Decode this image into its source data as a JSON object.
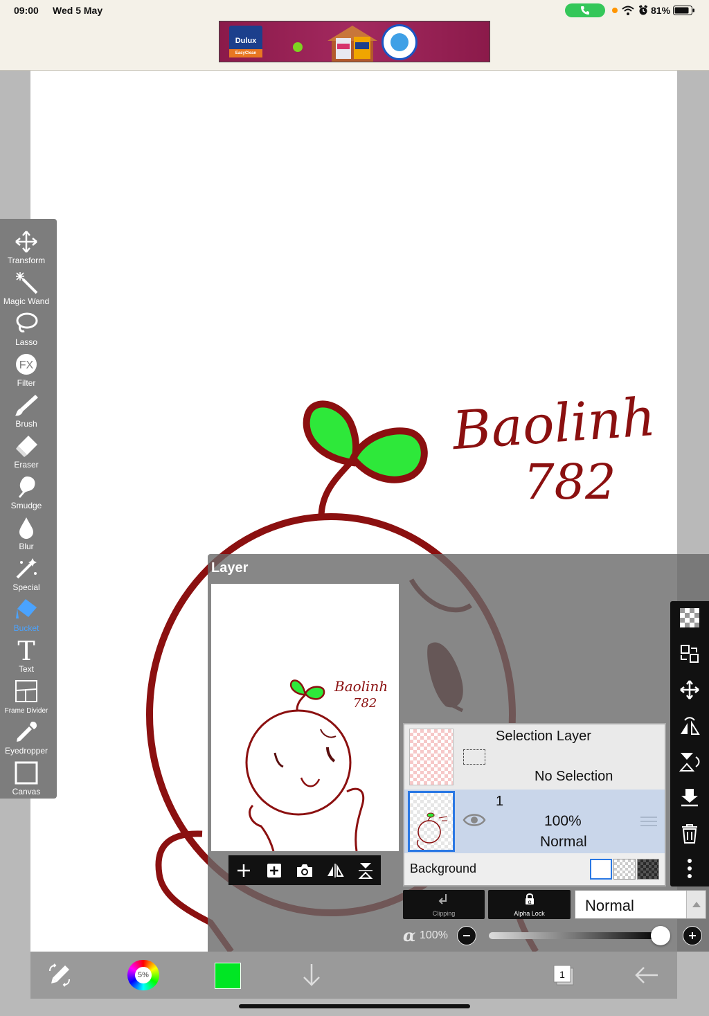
{
  "status_bar": {
    "time": "09:00",
    "date": "Wed 5 May",
    "battery": "81%",
    "icons": [
      "phone-call-icon",
      "wifi-icon",
      "alarm-icon",
      "battery-icon"
    ]
  },
  "ad": {
    "brand": "Dulux",
    "brand_sub": "EasyClean"
  },
  "artwork": {
    "signature_line1": "Baolinh",
    "signature_line2": "782"
  },
  "tools": [
    {
      "label": "Transform",
      "icon": "transform-icon"
    },
    {
      "label": "Magic Wand",
      "icon": "magic-wand-icon"
    },
    {
      "label": "Lasso",
      "icon": "lasso-icon"
    },
    {
      "label": "Filter",
      "icon": "fx-filter-icon",
      "glyph": "FX"
    },
    {
      "label": "Brush",
      "icon": "brush-icon"
    },
    {
      "label": "Eraser",
      "icon": "eraser-icon"
    },
    {
      "label": "Smudge",
      "icon": "smudge-icon"
    },
    {
      "label": "Blur",
      "icon": "blur-drop-icon"
    },
    {
      "label": "Special",
      "icon": "special-wand-icon"
    },
    {
      "label": "Bucket",
      "icon": "bucket-icon",
      "active": true
    },
    {
      "label": "Text",
      "icon": "text-icon",
      "glyph": "T"
    },
    {
      "label": "Frame Divider",
      "icon": "frame-divider-icon"
    },
    {
      "label": "Eyedropper",
      "icon": "eyedropper-icon"
    },
    {
      "label": "Canvas",
      "icon": "canvas-icon"
    }
  ],
  "layer_panel": {
    "title": "Layer",
    "selection_layer": {
      "name": "Selection Layer",
      "status": "No Selection"
    },
    "layer1": {
      "number": "1",
      "opacity": "100%",
      "blend": "Normal"
    },
    "background_label": "Background",
    "clipping_label": "Clipping",
    "alpha_lock_label": "Alpha Lock",
    "blend_mode": "Normal",
    "alpha_symbol": "α",
    "alpha_value": "100%",
    "alpha_level": 1.0
  },
  "bottom_bar": {
    "color_wheel_text": "5%",
    "current_color": "#00e624",
    "layer_count": "1"
  },
  "colors": {
    "accent_active": "#4aa3ff",
    "line_art": "#8b1010",
    "leaf_fill": "#2ee83a"
  }
}
